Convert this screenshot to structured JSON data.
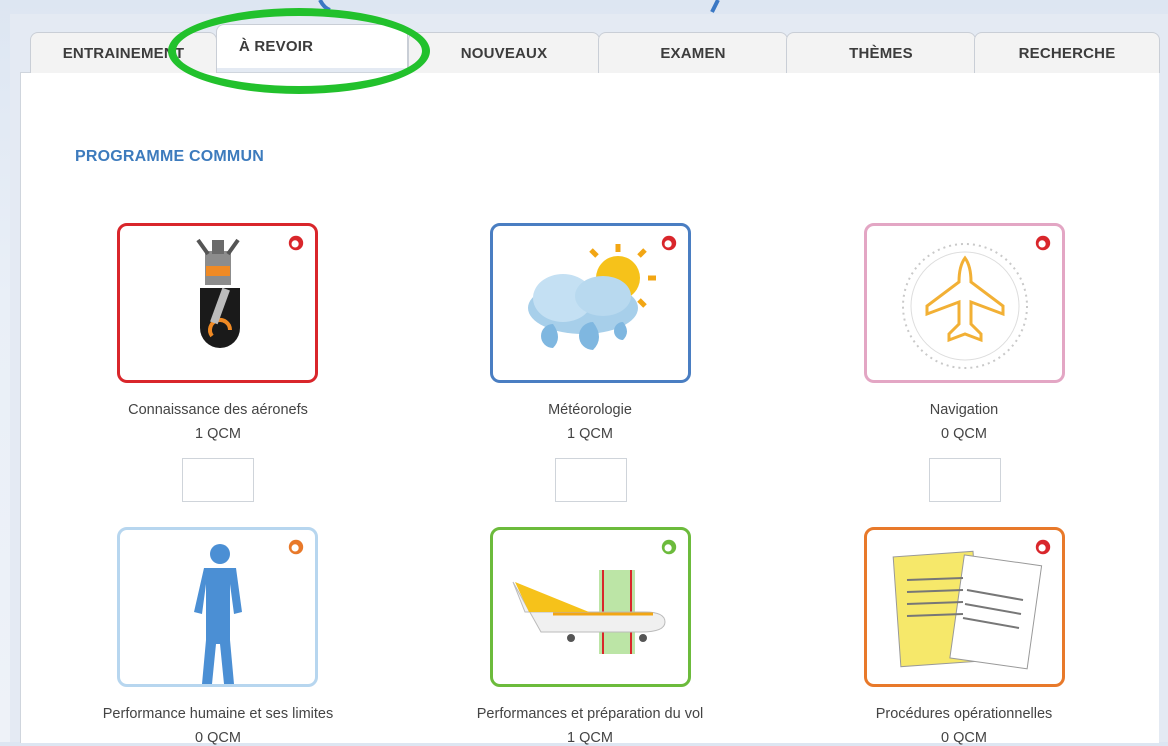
{
  "tabs": [
    {
      "label": "ENTRAINEMENT"
    },
    {
      "label": "À REVOIR"
    },
    {
      "label": "NOUVEAUX"
    },
    {
      "label": "EXAMEN"
    },
    {
      "label": "THÈMES"
    },
    {
      "label": "RECHERCHE"
    }
  ],
  "active_tab": "À REVOIR",
  "section_title": "PROGRAMME COMMUN",
  "cards": [
    {
      "label": "Connaissance des aéronefs",
      "count": "1 QCM",
      "color": "#d9262b",
      "icon": "engine-piston-icon"
    },
    {
      "label": "Météorologie",
      "count": "1 QCM",
      "color": "#4a7ec2",
      "icon": "weather-cloud-sun-icon"
    },
    {
      "label": "Navigation",
      "count": "0 QCM",
      "color": "#e3a6c4",
      "icon": "compass-plane-icon"
    },
    {
      "label": "Performance humaine et ses limites",
      "count": "0 QCM",
      "color": "#b7d6ef",
      "icon": "human-body-icon"
    },
    {
      "label": "Performances et préparation du vol",
      "count": "1 QCM",
      "color": "#6cbb3c",
      "icon": "airplane-balance-icon"
    },
    {
      "label": "Procédures opérationnelles",
      "count": "0 QCM",
      "color": "#e8792a",
      "icon": "documents-icon"
    }
  ],
  "colors": {
    "section_title": "#3d7bbd",
    "highlight_ring": "#22c12c"
  }
}
